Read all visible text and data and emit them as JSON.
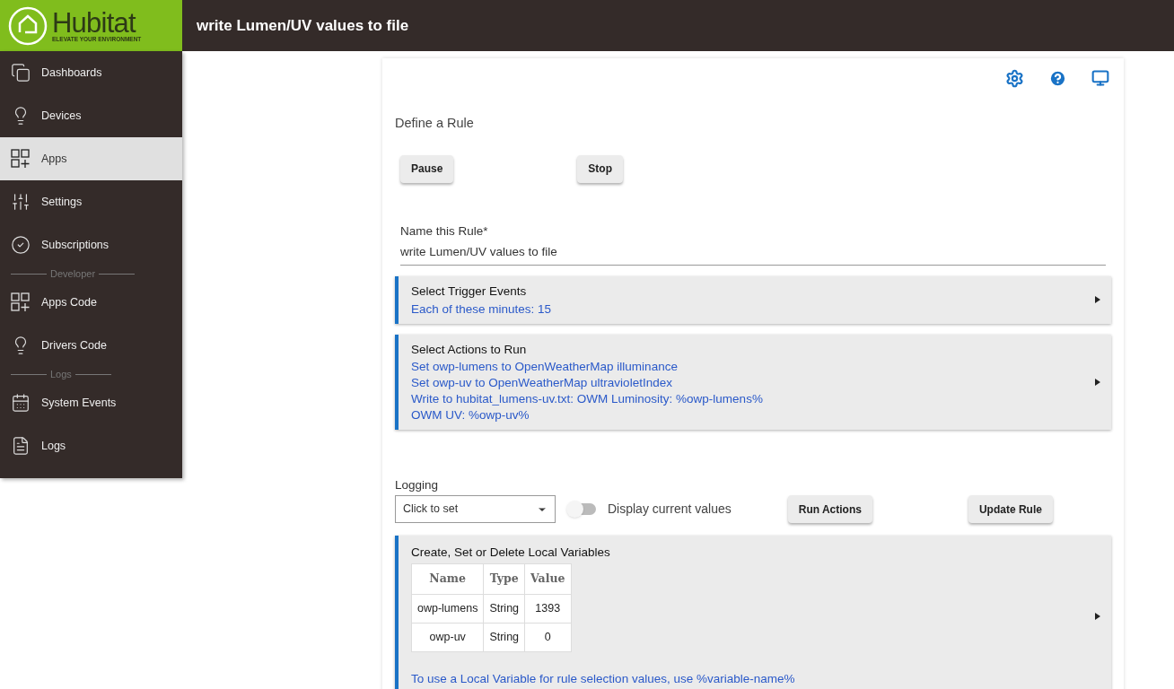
{
  "logo": {
    "name": "Hubitat",
    "tagline": "ELEVATE YOUR ENVIRONMENT"
  },
  "header": {
    "title": "write Lumen/UV values to file"
  },
  "sidebar": {
    "items": [
      {
        "kind": "item",
        "label": "Dashboards",
        "selected": false
      },
      {
        "kind": "item",
        "label": "Devices",
        "selected": false
      },
      {
        "kind": "item",
        "label": "Apps",
        "selected": true
      },
      {
        "kind": "item",
        "label": "Settings",
        "selected": false
      },
      {
        "kind": "item",
        "label": "Subscriptions",
        "selected": false
      },
      {
        "kind": "divider",
        "label": "Developer"
      },
      {
        "kind": "item",
        "label": "Apps Code",
        "selected": false
      },
      {
        "kind": "item",
        "label": "Drivers Code",
        "selected": false
      },
      {
        "kind": "divider",
        "label": "Logs"
      },
      {
        "kind": "item",
        "label": "System Events",
        "selected": false
      },
      {
        "kind": "item",
        "label": "Logs",
        "selected": false
      }
    ]
  },
  "page": {
    "heading": "Define a Rule",
    "top_buttons": [
      "Pause",
      "Stop"
    ],
    "name_field": {
      "label": "Name this Rule*",
      "value": "write Lumen/UV values to file"
    },
    "sections": [
      {
        "title": "Select Trigger Events",
        "lines": [
          "Each of these minutes: 15"
        ]
      },
      {
        "title": "Select Actions to Run",
        "lines": [
          "Set owp-lumens to OpenWeatherMap illuminance",
          "Set owp-uv to OpenWeatherMap ultravioletIndex",
          "Write to hubitat_lumens-uv.txt: OWM Luminosity: %owp-lumens%",
          "OWM UV: %owp-uv%"
        ]
      }
    ],
    "logging": {
      "label": "Logging",
      "value": "Click to set"
    },
    "display_toggle": {
      "label": "Display current values",
      "on": false
    },
    "action_buttons": [
      "Run Actions",
      "Update Rule"
    ],
    "variables": {
      "title": "Create, Set or Delete Local Variables",
      "columns": [
        "Name",
        "Type",
        "Value"
      ],
      "rows": [
        [
          "owp-lumens",
          "String",
          "1393"
        ],
        [
          "owp-uv",
          "String",
          "0"
        ]
      ],
      "note": "To use a Local Variable for rule selection values, use %variable-name%"
    }
  }
}
